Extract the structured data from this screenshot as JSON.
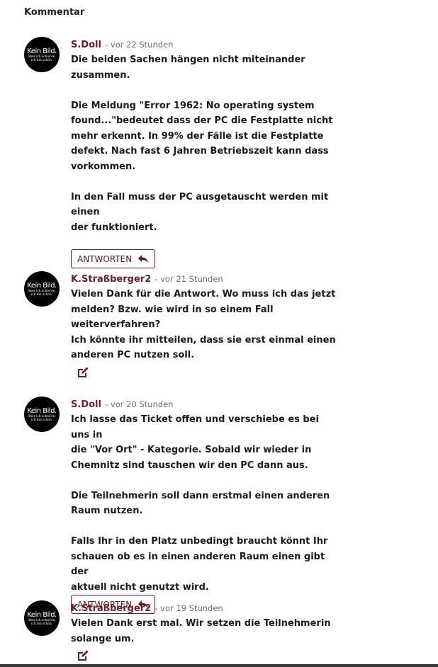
{
  "section": {
    "title": "Kommentar"
  },
  "comments": [
    {
      "author": "S.Doll",
      "time": "- vor 22 Stunden",
      "avatar": {
        "line1": "Kein Bild.",
        "line2": "Aber ich schwöre, ich bin schön."
      },
      "text": "Die beiden Sachen hängen nicht miteinander\nzusammen.\n\nDie Meldung \"Error 1962: No operating system\nfound...\"bedeutet dass der PC die Festplatte nicht\nmehr erkennt. In 99% der Fälle ist die Festplatte\ndefekt. Nach fast 6 Jahren Betriebszeit kann dass\nvorkommen.\n\nIn den Fall muss der PC ausgetauscht werden mit einen\nder funktioniert.",
      "reply_label": "ANTWORTEN"
    },
    {
      "author": "K.Straßberger2",
      "time": "- vor 21 Stunden",
      "avatar": {
        "line1": "Kein Bild.",
        "line2": "Aber ich schwöre, ich bin schön."
      },
      "text": "Vielen Dank für die Antwort. Wo muss ich das jetzt\nmelden? Bzw. wie wird in so einem Fall\nweiterverfahren?\nIch könnte ihr mitteilen, dass sie erst einmal einen\nanderen PC nutzen soll."
    },
    {
      "author": "S.Doll",
      "time": "- vor 20 Stunden",
      "avatar": {
        "line1": "Kein Bild.",
        "line2": "Aber ich schwöre, ich bin schön."
      },
      "text": "Ich lasse das Ticket offen und verschiebe es bei uns in\ndie \"Vor Ort\" - Kategorie. Sobald wir wieder in\nChemnitz sind tauschen wir den PC dann aus.\n\nDie Teilnehmerin soll dann erstmal einen anderen\nRaum nutzen.\n\nFalls Ihr in den Platz unbedingt braucht könnt Ihr\nschauen ob es in einen anderen Raum einen gibt der\naktuell nicht genutzt wird.",
      "reply_label": "ANTWORTEN"
    },
    {
      "author": "K.Straßberger2",
      "time": "- vor 19 Stunden",
      "avatar": {
        "line1": "Kein Bild.",
        "line2": "Aber ich schwöre, ich bin schön."
      },
      "text": "Vielen Dank erst mal. Wir setzen die Teilnehmerin\nsolange um."
    }
  ],
  "colors": {
    "author": "#6d1c2a",
    "button_border": "#6d1c2a"
  },
  "icons": {
    "reply": "reply-arrow-icon",
    "edit": "edit-icon"
  }
}
